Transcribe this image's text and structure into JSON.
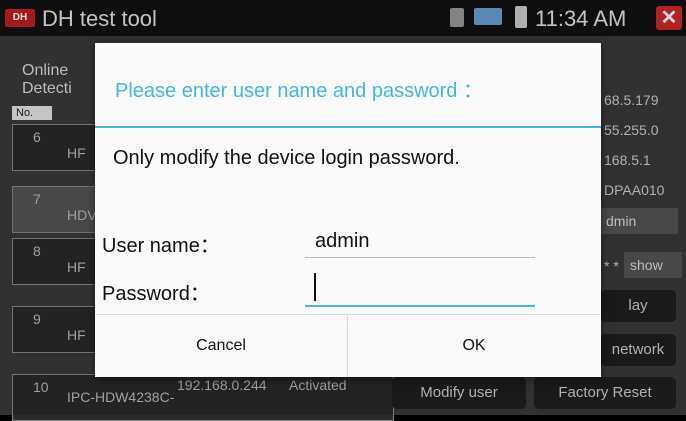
{
  "statusbar": {
    "app_logo": "DH",
    "app_title": "DH test tool",
    "time": "11:34 AM",
    "icons": [
      "sd-card-icon",
      "monitor-icon",
      "battery-icon",
      "close-icon"
    ]
  },
  "background": {
    "title_line1": "Online",
    "title_line2": "Detecti",
    "col_no": "No.",
    "rows": [
      {
        "num": "6",
        "model": "HF",
        "ip": "",
        "state": ""
      },
      {
        "num": "7",
        "model": "HDV",
        "ip": "",
        "state": ""
      },
      {
        "num": "8",
        "model": "HF",
        "ip": "",
        "state": ""
      },
      {
        "num": "9",
        "model": "HF",
        "ip": "",
        "state": ""
      },
      {
        "num": "10",
        "model": "IPC-HDW4238C-",
        "ip": "192.168.0.244",
        "state": "Activated"
      }
    ],
    "right_info": [
      "68.5.179",
      "55.255.0",
      "168.5.1",
      "DPAA010"
    ],
    "right_fields": [
      "dmin"
    ],
    "password_mask": "* *",
    "show_label": "show",
    "buttons": [
      "lay",
      "network",
      "Modify user",
      "Factory Reset"
    ]
  },
  "dialog": {
    "title": "Please enter user name and password ：",
    "message": "Only modify the device login password.",
    "username_label": "User name：",
    "username_value": "admin",
    "password_label": "Password：",
    "password_value": "",
    "cancel_label": "Cancel",
    "ok_label": "OK"
  }
}
